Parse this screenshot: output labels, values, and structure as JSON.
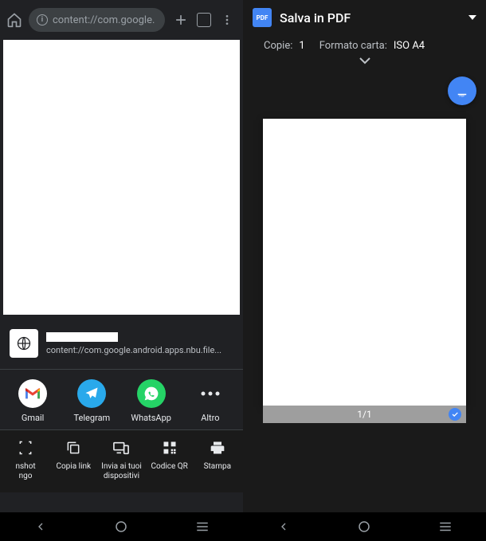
{
  "left": {
    "url": "content://com.google.",
    "share": {
      "url": "content://com.google.android.apps.nbu.file..."
    },
    "apps": [
      {
        "label": "Gmail"
      },
      {
        "label": "Telegram"
      },
      {
        "label": "WhatsApp"
      },
      {
        "label": "Altro"
      }
    ],
    "actions": [
      {
        "label": "nshot\nngo"
      },
      {
        "label": "Copia link"
      },
      {
        "label": "Invia ai tuoi\ndispositivi"
      },
      {
        "label": "Codice QR"
      },
      {
        "label": "Stampa"
      }
    ]
  },
  "right": {
    "title": "Salva in PDF",
    "copies_label": "Copie:",
    "copies_value": "1",
    "paper_label": "Formato carta:",
    "paper_value": "ISO A4",
    "page_indicator": "1/1"
  }
}
